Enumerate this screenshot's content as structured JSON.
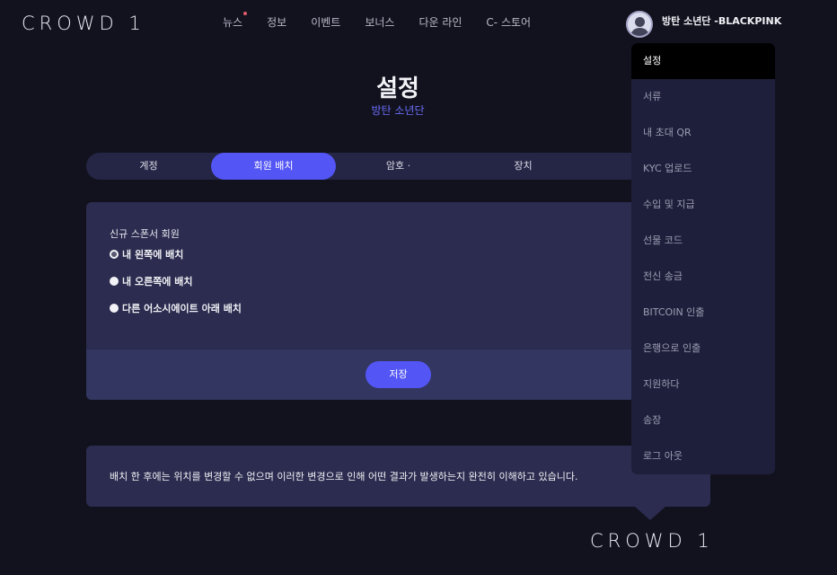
{
  "brand": {
    "logo": "CROWD 1",
    "logo_footer": "CROWD 1"
  },
  "nav": [
    {
      "label": "뉴스",
      "dot": true
    },
    {
      "label": "정보"
    },
    {
      "label": "이벤트"
    },
    {
      "label": "보너스"
    },
    {
      "label": "다운 라인"
    },
    {
      "label": "C- 스토어"
    }
  ],
  "user": {
    "name": "방탄 소년단 -BLACKPINK",
    "avatar_icon": "user-avatar-icon"
  },
  "page": {
    "title": "설정",
    "subtitle": "방탄 소년단"
  },
  "tabs": [
    {
      "label": "계정",
      "active": false
    },
    {
      "label": "회원 배치",
      "active": true
    },
    {
      "label": "암호 ·",
      "active": false
    },
    {
      "label": "장치",
      "active": false
    }
  ],
  "placement": {
    "section_label": "신규 스폰서 회원",
    "options": [
      {
        "label": "내 왼쪽에 배치",
        "checked": true
      },
      {
        "label": "내 오른쪽에 배치",
        "checked": false
      },
      {
        "label": "다른 어소시에이트 아래 배치",
        "checked": false
      }
    ],
    "save_label": "저장"
  },
  "notice": {
    "text": "배치 한 후에는 위치를 변경할 수 없으며 이러한 변경으로 인해 어떤 결과가 발생하는지 완전히 이해하고 있습니다."
  },
  "dropdown": [
    {
      "label": "설정",
      "active": true
    },
    {
      "label": "서류"
    },
    {
      "label": "내 초대 QR"
    },
    {
      "label": "KYC 업로드"
    },
    {
      "label": "수입 및 지급"
    },
    {
      "label": "선물 코드"
    },
    {
      "label": "전신 송금"
    },
    {
      "label": "BITCOIN 인출"
    },
    {
      "label": "은행으로 인출"
    },
    {
      "label": "지원하다"
    },
    {
      "label": "송장"
    },
    {
      "label": "로그 아웃"
    }
  ],
  "colors": {
    "background": "#12121f",
    "accent": "#5355f5",
    "panel": "#2b2c4f",
    "subtitle": "#6a6cf5",
    "notification_dot": "#e05a6a"
  }
}
